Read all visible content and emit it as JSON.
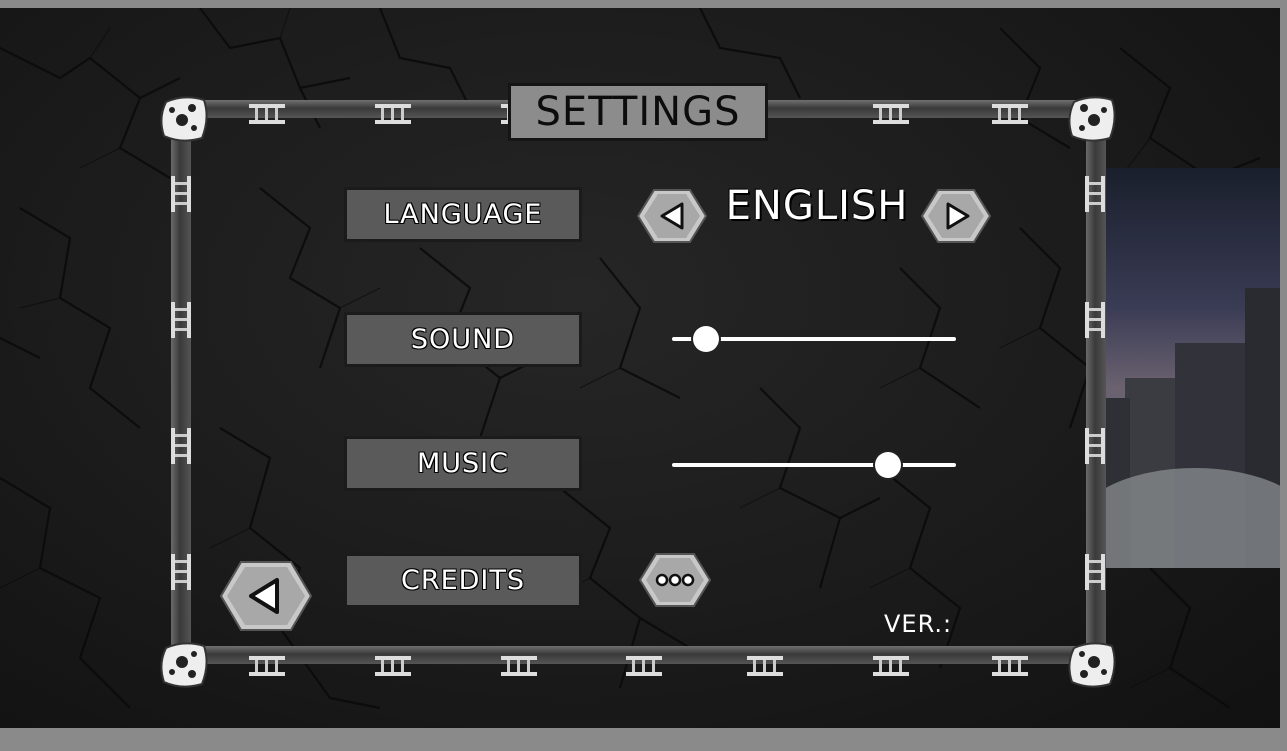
{
  "title": "SETTINGS",
  "language": {
    "label": "LANGUAGE",
    "value": "ENGLISH",
    "prev_icon": "triangle-left-icon",
    "next_icon": "triangle-right-icon"
  },
  "sound": {
    "label": "SOUND",
    "level": 0.12
  },
  "music": {
    "label": "MUSIC",
    "level": 0.76
  },
  "credits": {
    "label": "CREDITS",
    "more_icon": "three-dots-icon"
  },
  "back_icon": "triangle-left-icon",
  "version_label": "VER.:",
  "colors": {
    "background": "#1b1b1b",
    "frame": "#4a4a4a",
    "label_fill": "#5a5a5a",
    "title_fill": "#8c8c8c",
    "text": "#ffffff"
  }
}
